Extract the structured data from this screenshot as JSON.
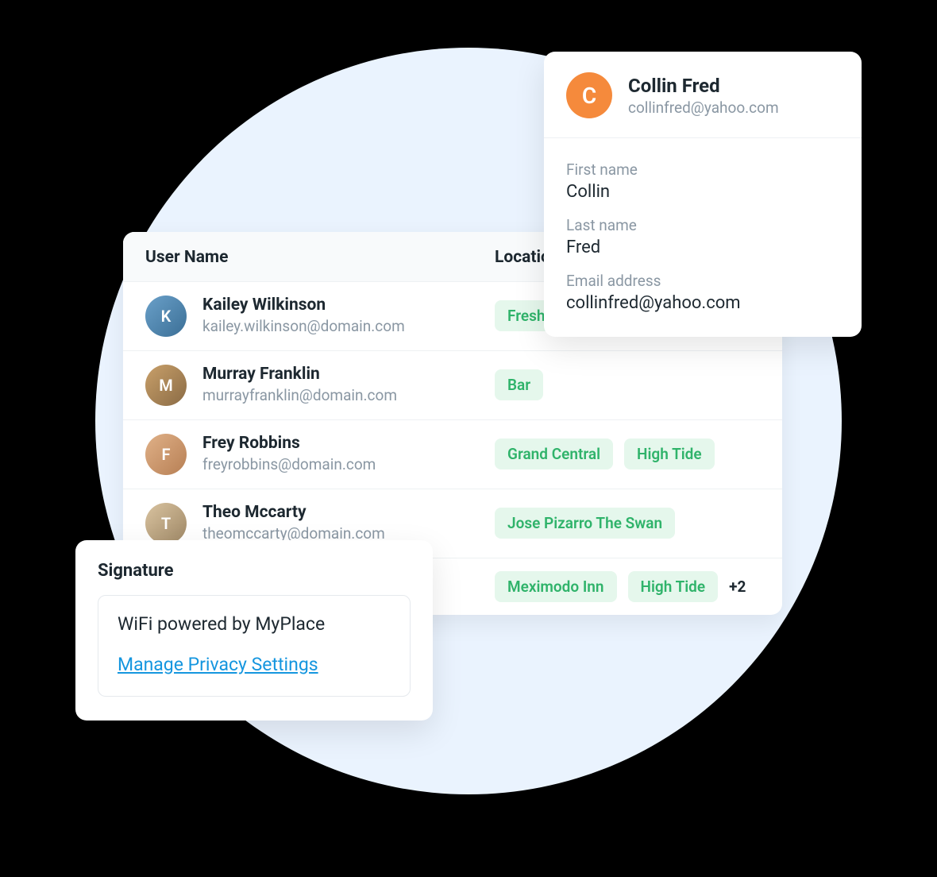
{
  "table": {
    "headers": {
      "user": "User Name",
      "location": "Location"
    },
    "rows": [
      {
        "name": "Kailey Wilkinson",
        "email": "kailey.wilkinson@domain.com",
        "initial": "K",
        "avatar_class": "av1",
        "locations": [
          "Fresh"
        ],
        "more": ""
      },
      {
        "name": "Murray Franklin",
        "email": "murrayfranklin@domain.com",
        "initial": "M",
        "avatar_class": "av2",
        "locations": [
          "Bar"
        ],
        "more": ""
      },
      {
        "name": "Frey Robbins",
        "email": "freyrobbins@domain.com",
        "initial": "F",
        "avatar_class": "av3",
        "locations": [
          "Grand Central",
          "High Tide"
        ],
        "more": ""
      },
      {
        "name": "Theo Mccarty",
        "email": "theomccarty@domain.com",
        "initial": "T",
        "avatar_class": "av4",
        "locations": [
          "Jose Pizarro The Swan"
        ],
        "more": ""
      },
      {
        "name": "",
        "email": "",
        "initial": "",
        "avatar_class": "",
        "locations": [
          "Meximodo Inn",
          "High Tide"
        ],
        "more": "+2"
      }
    ]
  },
  "profile": {
    "avatar_initial": "C",
    "name": "Collin Fred",
    "email": "collinfred@yahoo.com",
    "fields": {
      "first_name_label": "First name",
      "first_name_value": "Collin",
      "last_name_label": "Last name",
      "last_name_value": "Fred",
      "email_label": "Email address",
      "email_value": "collinfred@yahoo.com"
    }
  },
  "signature": {
    "title": "Signature",
    "text": "WiFi powered by MyPlace",
    "link": "Manage Privacy Settings"
  }
}
